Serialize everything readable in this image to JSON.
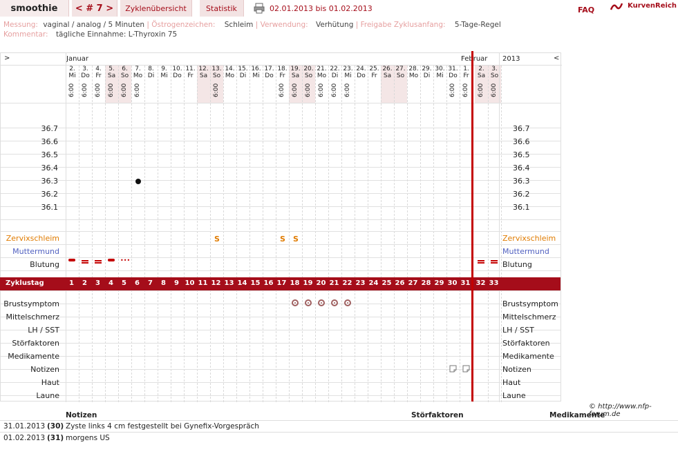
{
  "topbar": {
    "user": "smoothie",
    "cycle": "< # 7 >",
    "tab1": "Zyklenübersicht",
    "tab2": "Statistik",
    "range": "02.01.2013 bis 01.02.2013",
    "faq": "FAQ",
    "logo": "KurvenReich"
  },
  "meta": {
    "messung_label": "Messung:",
    "messung": "vaginal / analog / 5 Minuten",
    "oestrogen_label": "Östrogenzeichen:",
    "oestrogen": "Schleim",
    "verwendung_label": "Verwendung:",
    "verwendung": "Verhütung",
    "freigabe_label": "Freigabe Zyklusanfang:",
    "freigabe": "5-Tage-Regel",
    "kommentar_label": "Kommentar:",
    "kommentar": "tägliche Einnahme: L-Thyroxin 75"
  },
  "chart": {
    "nav_left": ">",
    "nav_right": "<",
    "month1": "Januar",
    "month2": "Februar",
    "year": "2013",
    "days": [
      {
        "d": "2.",
        "w": "Mi",
        "t": "6:00"
      },
      {
        "d": "3.",
        "w": "Do",
        "t": "6:00"
      },
      {
        "d": "4.",
        "w": "Fr",
        "t": "6:00"
      },
      {
        "d": "5.",
        "w": "Sa",
        "t": "6:00"
      },
      {
        "d": "6.",
        "w": "So",
        "t": "6:00"
      },
      {
        "d": "7.",
        "w": "Mo",
        "t": "6:00"
      },
      {
        "d": "8.",
        "w": "Di",
        "t": ""
      },
      {
        "d": "9.",
        "w": "Mi",
        "t": ""
      },
      {
        "d": "10.",
        "w": "Do",
        "t": ""
      },
      {
        "d": "11.",
        "w": "Fr",
        "t": ""
      },
      {
        "d": "12.",
        "w": "Sa",
        "t": ""
      },
      {
        "d": "13.",
        "w": "So",
        "t": "6:00"
      },
      {
        "d": "14.",
        "w": "Mo",
        "t": ""
      },
      {
        "d": "15.",
        "w": "Di",
        "t": ""
      },
      {
        "d": "16.",
        "w": "Mi",
        "t": ""
      },
      {
        "d": "17.",
        "w": "Do",
        "t": ""
      },
      {
        "d": "18.",
        "w": "Fr",
        "t": "6:00"
      },
      {
        "d": "19.",
        "w": "Sa",
        "t": "6:00"
      },
      {
        "d": "20.",
        "w": "So",
        "t": "6:00"
      },
      {
        "d": "21.",
        "w": "Mo",
        "t": "6:00"
      },
      {
        "d": "22.",
        "w": "Di",
        "t": "6:00"
      },
      {
        "d": "23.",
        "w": "Mi",
        "t": "6:00"
      },
      {
        "d": "24.",
        "w": "Do",
        "t": ""
      },
      {
        "d": "25.",
        "w": "Fr",
        "t": ""
      },
      {
        "d": "26.",
        "w": "Sa",
        "t": ""
      },
      {
        "d": "27.",
        "w": "So",
        "t": ""
      },
      {
        "d": "28.",
        "w": "Mo",
        "t": ""
      },
      {
        "d": "29.",
        "w": "Di",
        "t": ""
      },
      {
        "d": "30.",
        "w": "Mi",
        "t": ""
      },
      {
        "d": "31.",
        "w": "Do",
        "t": "6:00"
      },
      {
        "d": "1.",
        "w": "Fr",
        "t": "6:00"
      },
      {
        "d": "2.",
        "w": "Sa",
        "t": "6:00"
      },
      {
        "d": "3.",
        "w": "So",
        "t": "6:00"
      }
    ],
    "temps": [
      "36.7",
      "36.6",
      "36.5",
      "36.4",
      "36.3",
      "36.2",
      "36.1"
    ],
    "temperature_points": [
      {
        "cycle_day": 6,
        "value": 36.3
      }
    ],
    "rows": {
      "zervix": "Zervixschleim",
      "muttermund": "Muttermund",
      "blutung": "Blutung",
      "zyklustag": "Zyklustag",
      "brust": "Brustsymptom",
      "mittel": "Mittelschmerz",
      "lh": "LH / SST",
      "stoer": "Störfaktoren",
      "medi": "Medikamente",
      "notizen": "Notizen",
      "haut": "Haut",
      "laune": "Laune"
    },
    "zervix_days": [
      12,
      17,
      18
    ],
    "zervix_mark": "S",
    "bleeding": [
      {
        "day": 1,
        "kind": "dash"
      },
      {
        "day": 2,
        "kind": "double"
      },
      {
        "day": 3,
        "kind": "double"
      },
      {
        "day": 4,
        "kind": "dash"
      },
      {
        "day": 5,
        "kind": "dots"
      },
      {
        "day": 32,
        "kind": "double"
      },
      {
        "day": 33,
        "kind": "double"
      }
    ],
    "breast_days": [
      18,
      19,
      20,
      21,
      22
    ],
    "note_days": [
      30,
      31
    ],
    "zyklustage": [
      "1",
      "2",
      "3",
      "4",
      "5",
      "6",
      "7",
      "8",
      "9",
      "10",
      "11",
      "12",
      "13",
      "14",
      "15",
      "16",
      "17",
      "18",
      "19",
      "20",
      "21",
      "22",
      "23",
      "24",
      "25",
      "26",
      "27",
      "28",
      "29",
      "30",
      "31",
      "32",
      "33"
    ],
    "copyright": "© http://www.nfp-forum.de"
  },
  "notes": {
    "h_notizen": "Notizen",
    "h_stoer": "Störfaktoren",
    "h_medi": "Medikamente",
    "rows": [
      {
        "date": "31.01.2013",
        "day": "(30)",
        "text": "Zyste links 4 cm festgestellt bei Gynefix-Vorgespräch"
      },
      {
        "date": "01.02.2013",
        "day": "(31)",
        "text": "morgens US"
      }
    ]
  }
}
